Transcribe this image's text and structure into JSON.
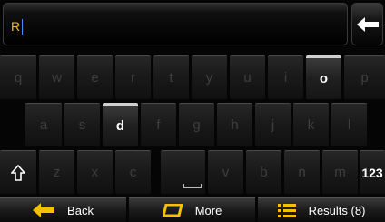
{
  "search": {
    "value": "R"
  },
  "keyboard": {
    "rows": [
      [
        {
          "label": "q",
          "active": false
        },
        {
          "label": "w",
          "active": false
        },
        {
          "label": "e",
          "active": false
        },
        {
          "label": "r",
          "active": false
        },
        {
          "label": "t",
          "active": false
        },
        {
          "label": "y",
          "active": false
        },
        {
          "label": "u",
          "active": false
        },
        {
          "label": "i",
          "active": false
        },
        {
          "label": "o",
          "active": true
        },
        {
          "label": "p",
          "active": false
        }
      ],
      [
        {
          "label": "a",
          "active": false
        },
        {
          "label": "s",
          "active": false
        },
        {
          "label": "d",
          "active": true
        },
        {
          "label": "f",
          "active": false
        },
        {
          "label": "g",
          "active": false
        },
        {
          "label": "h",
          "active": false
        },
        {
          "label": "j",
          "active": false
        },
        {
          "label": "k",
          "active": false
        },
        {
          "label": "l",
          "active": false
        }
      ],
      [
        {
          "label": "z",
          "active": false
        },
        {
          "label": "x",
          "active": false
        },
        {
          "label": "c",
          "active": false
        },
        {
          "label": "v",
          "active": false
        },
        {
          "label": "b",
          "active": false
        },
        {
          "label": "n",
          "active": false
        },
        {
          "label": "m",
          "active": false
        }
      ]
    ],
    "numeric_label": "123"
  },
  "bottom_bar": {
    "back_label": "Back",
    "more_label": "More",
    "results_label": "Results (8)"
  },
  "colors": {
    "input_text": "#f4c000",
    "key_active_text": "#ffffff",
    "key_inactive_text": "#3f3f3f",
    "more_icon": "#f4c000",
    "accent_white": "#ffffff"
  }
}
